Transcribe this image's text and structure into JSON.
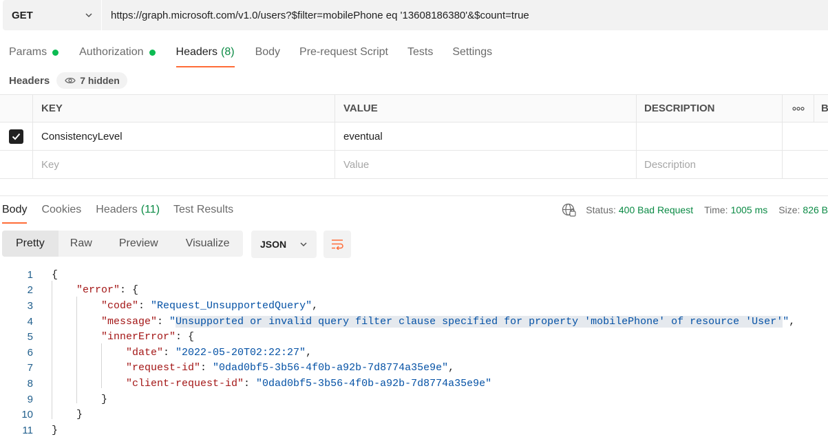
{
  "request": {
    "method": "GET",
    "url": "https://graph.microsoft.com/v1.0/users?$filter=mobilePhone eq '13608186380'&$count=true"
  },
  "request_tabs": [
    {
      "label": "Params",
      "dot": true
    },
    {
      "label": "Authorization",
      "dot": true
    },
    {
      "label": "Headers",
      "count": "(8)",
      "active": true
    },
    {
      "label": "Body"
    },
    {
      "label": "Pre-request Script"
    },
    {
      "label": "Tests"
    },
    {
      "label": "Settings"
    }
  ],
  "headers_section": {
    "title": "Headers",
    "hidden_label": "7 hidden"
  },
  "headers_table": {
    "columns": [
      "KEY",
      "VALUE",
      "DESCRIPTION",
      "ooo",
      "B"
    ],
    "rows": [
      {
        "checked": true,
        "key": "ConsistencyLevel",
        "value": "eventual",
        "description": ""
      }
    ],
    "placeholders": {
      "key": "Key",
      "value": "Value",
      "description": "Description"
    }
  },
  "response_tabs": [
    {
      "label": "Body",
      "active": true
    },
    {
      "label": "Cookies"
    },
    {
      "label": "Headers",
      "count": "(11)"
    },
    {
      "label": "Test Results"
    }
  ],
  "status": {
    "status_label": "Status:",
    "status_value": "400 Bad Request",
    "time_label": "Time:",
    "time_value": "1005 ms",
    "size_label": "Size:",
    "size_value": "826 B"
  },
  "view_modes": [
    "Pretty",
    "Raw",
    "Preview",
    "Visualize"
  ],
  "format": "JSON",
  "code_lines": [
    {
      "n": "1",
      "text": "{"
    },
    {
      "n": "2",
      "key": "\"error\"",
      "rest": ": {"
    },
    {
      "n": "3",
      "key": "\"code\"",
      "sep": ": ",
      "val": "\"Request_UnsupportedQuery\"",
      "end": ","
    },
    {
      "n": "4",
      "key": "\"message\"",
      "sep": ": ",
      "val_q1": "\"",
      "val": "Unsupported or invalid query filter clause specified for property 'mobilePhone' of resource 'User'",
      "val_q2": "\"",
      "end": ","
    },
    {
      "n": "5",
      "key": "\"innerError\"",
      "rest": ": {"
    },
    {
      "n": "6",
      "key": "\"date\"",
      "sep": ": ",
      "val": "\"2022-05-20T02:22:27\"",
      "end": ","
    },
    {
      "n": "7",
      "key": "\"request-id\"",
      "sep": ": ",
      "val": "\"0dad0bf5-3b56-4f0b-a92b-7d8774a35e9e\"",
      "end": ","
    },
    {
      "n": "8",
      "key": "\"client-request-id\"",
      "sep": ": ",
      "val": "\"0dad0bf5-3b56-4f0b-a92b-7d8774a35e9e\"",
      "end": ""
    },
    {
      "n": "9",
      "text": "}"
    },
    {
      "n": "10",
      "text": "}"
    },
    {
      "n": "11",
      "text": "}"
    }
  ],
  "icons": {
    "method_dropdown": "chevron-down-icon",
    "hidden": "eye-icon",
    "checkbox": "check-icon",
    "more": "more-horizontal-icon",
    "network": "globe-icon",
    "format_dropdown": "chevron-down-icon",
    "wrap": "wrap-lines-icon"
  },
  "colors": {
    "accent": "#ff6c37",
    "success": "#0cbb52",
    "status_green": "#0a8a44",
    "json_key": "#a31515",
    "json_string": "#0451a5"
  }
}
